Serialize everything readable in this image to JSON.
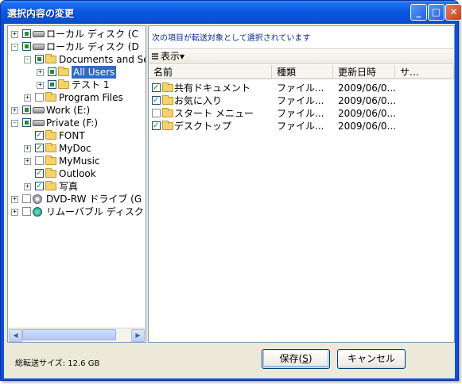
{
  "window": {
    "title": "選択内容の変更"
  },
  "tree": {
    "items": [
      {
        "label": "ローカル ディスク (C",
        "level": 0,
        "expander": "+",
        "check": "partial",
        "icon": "drive-icon"
      },
      {
        "label": "ローカル ディスク (D",
        "level": 0,
        "expander": "-",
        "check": "partial",
        "icon": "drive-icon"
      },
      {
        "label": "Documents and Set",
        "level": 1,
        "expander": "-",
        "check": "partial",
        "icon": "folder-icon"
      },
      {
        "label": "All Users",
        "level": 2,
        "expander": "+",
        "check": "partial",
        "icon": "folder-icon",
        "selected": true
      },
      {
        "label": "テスト 1",
        "level": 2,
        "expander": "+",
        "check": "partial",
        "icon": "folder-icon"
      },
      {
        "label": "Program Files",
        "level": 1,
        "expander": "+",
        "check": "unchecked",
        "icon": "folder-icon"
      },
      {
        "label": "Work (E:)",
        "level": 0,
        "expander": "+",
        "check": "partial",
        "icon": "drive-icon"
      },
      {
        "label": "Private (F:)",
        "level": 0,
        "expander": "-",
        "check": "partial",
        "icon": "drive-icon"
      },
      {
        "label": "FONT",
        "level": 1,
        "expander": "",
        "check": "checked",
        "icon": "folder-icon"
      },
      {
        "label": "MyDoc",
        "level": 1,
        "expander": "+",
        "check": "checked",
        "icon": "folder-icon"
      },
      {
        "label": "MyMusic",
        "level": 1,
        "expander": "+",
        "check": "unchecked",
        "icon": "folder-icon"
      },
      {
        "label": "Outlook",
        "level": 1,
        "expander": "",
        "check": "checked",
        "icon": "folder-icon"
      },
      {
        "label": "写真",
        "level": 1,
        "expander": "+",
        "check": "checked",
        "icon": "folder-icon"
      },
      {
        "label": "DVD-RW ドライブ (G",
        "level": 0,
        "expander": "+",
        "check": "unchecked",
        "icon": "dvd-icon"
      },
      {
        "label": "リムーバブル ディスク",
        "level": 0,
        "expander": "+",
        "check": "unchecked",
        "icon": "removable-disk-icon"
      }
    ]
  },
  "right": {
    "info": "次の項目が転送対象として選択されています",
    "view_button": "表示▾",
    "columns": [
      "名前",
      "種類",
      "更新日時",
      "サ…"
    ],
    "rows": [
      {
        "check": "checked",
        "name": "共有ドキュメント",
        "type": "ファイル...",
        "date": "2009/06/0..."
      },
      {
        "check": "checked",
        "name": "お気に入り",
        "type": "ファイル...",
        "date": "2009/06/0..."
      },
      {
        "check": "unchecked",
        "name": "スタート メニュー",
        "type": "ファイル...",
        "date": "2009/06/0..."
      },
      {
        "check": "checked",
        "name": "デスクトップ",
        "type": "ファイル...",
        "date": "2009/06/0..."
      }
    ]
  },
  "footer": {
    "total": "総転送サイズ: 12.6 GB",
    "save_label": "保存(",
    "save_key": "S",
    "save_suffix": ")",
    "cancel_label": "キャンセル"
  }
}
